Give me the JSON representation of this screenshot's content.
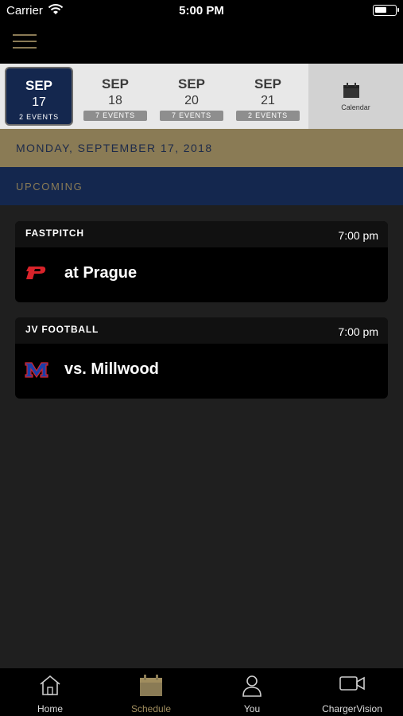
{
  "status_bar": {
    "carrier": "Carrier",
    "time": "5:00 PM"
  },
  "date_strip": {
    "dates": [
      {
        "month": "SEP",
        "day": "17",
        "events": "2 EVENTS",
        "selected": true
      },
      {
        "month": "SEP",
        "day": "18",
        "events": "7 EVENTS",
        "selected": false
      },
      {
        "month": "SEP",
        "day": "20",
        "events": "7 EVENTS",
        "selected": false
      },
      {
        "month": "SEP",
        "day": "21",
        "events": "2 EVENTS",
        "selected": false
      }
    ],
    "calendar_label": "Calendar"
  },
  "date_header": "MONDAY, SEPTEMBER 17, 2018",
  "section_label": "UPCOMING",
  "events": [
    {
      "sport": "FASTPITCH",
      "time": "7:00 pm",
      "opponent": "at Prague",
      "logo_icon": "prague-p-logo"
    },
    {
      "sport": "JV FOOTBALL",
      "time": "7:00 pm",
      "opponent": "vs. Millwood",
      "logo_icon": "millwood-m-logo"
    }
  ],
  "tab_bar": {
    "tabs": [
      {
        "label": "Home",
        "icon": "home-icon"
      },
      {
        "label": "Schedule",
        "icon": "calendar-icon",
        "active": true
      },
      {
        "label": "You",
        "icon": "person-icon"
      },
      {
        "label": "ChargerVision",
        "icon": "video-camera-icon"
      }
    ]
  },
  "colors": {
    "navy": "#14274e",
    "gold": "#8a7b55",
    "background": "#1f1f1f"
  }
}
